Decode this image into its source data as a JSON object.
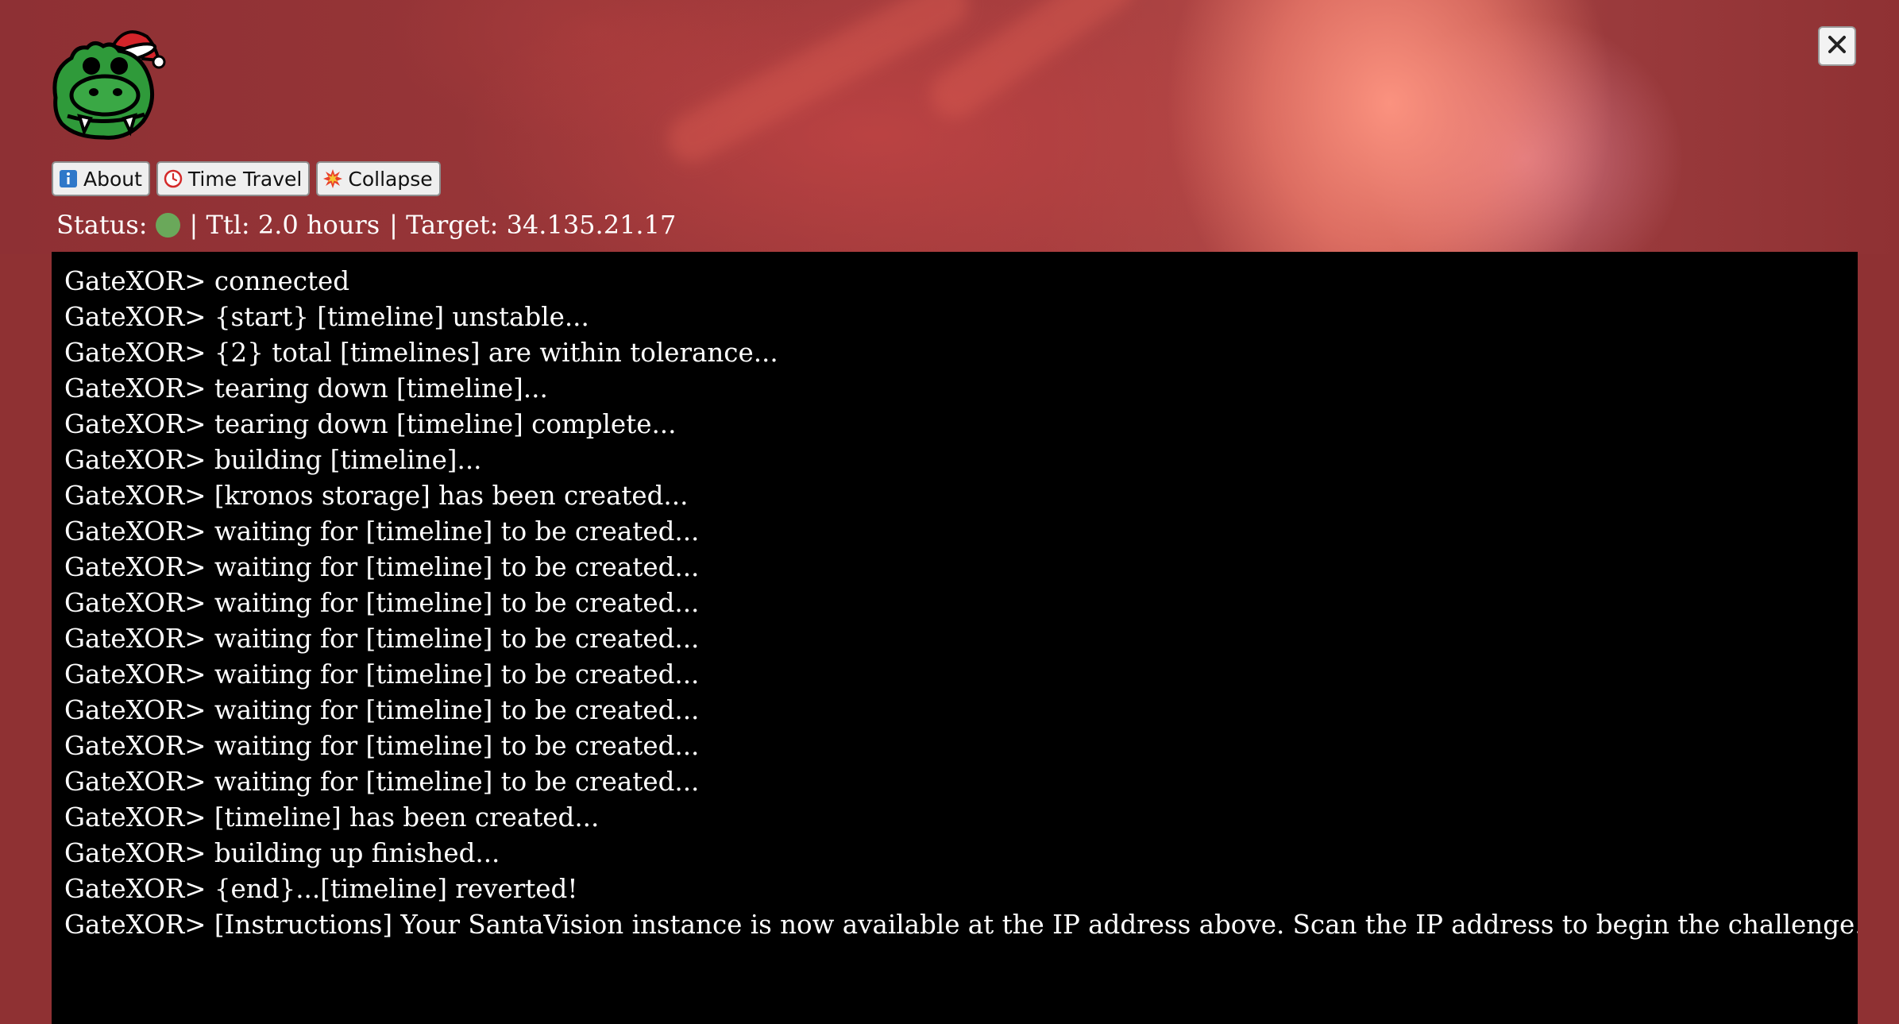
{
  "window": {
    "close_label": "×",
    "close_icon": "close-icon"
  },
  "logo": {
    "icon": "gator-santa-hat-logo",
    "colors": {
      "body": "#2f9a3a",
      "hat": "#d4242a",
      "outline": "#000000"
    }
  },
  "toolbar": {
    "buttons": [
      {
        "label": "About",
        "icon": "info-icon"
      },
      {
        "label": "Time Travel",
        "icon": "clock-icon"
      },
      {
        "label": "Collapse",
        "icon": "burst-icon"
      }
    ]
  },
  "status": {
    "prefix": "Status:",
    "indicator_color": "#6aa85a",
    "ttl": "| Ttl: 2.0 hours",
    "target": "| Target: 34.135.21.17"
  },
  "terminal": {
    "lines": [
      "GateXOR> connected",
      "GateXOR> {start} [timeline] unstable...",
      "GateXOR> {2} total [timelines] are within tolerance...",
      "GateXOR> tearing down [timeline]...",
      "GateXOR> tearing down [timeline] complete...",
      "GateXOR> building [timeline]...",
      "GateXOR> [kronos storage] has been created...",
      "GateXOR> waiting for [timeline] to be created...",
      "GateXOR> waiting for [timeline] to be created...",
      "GateXOR> waiting for [timeline] to be created...",
      "GateXOR> waiting for [timeline] to be created...",
      "GateXOR> waiting for [timeline] to be created...",
      "GateXOR> waiting for [timeline] to be created...",
      "GateXOR> waiting for [timeline] to be created...",
      "GateXOR> waiting for [timeline] to be created...",
      "GateXOR> [timeline] has been created...",
      "GateXOR> building up finished...",
      "GateXOR> {end}...[timeline] reverted!",
      "GateXOR> [Instructions] Your SantaVision instance is now available at the IP address above. Scan the IP address to begin the challenge. Good luck!!"
    ]
  },
  "colors": {
    "page_background": "#8f3133",
    "terminal_background": "#000000",
    "terminal_text": "#ffffff"
  }
}
